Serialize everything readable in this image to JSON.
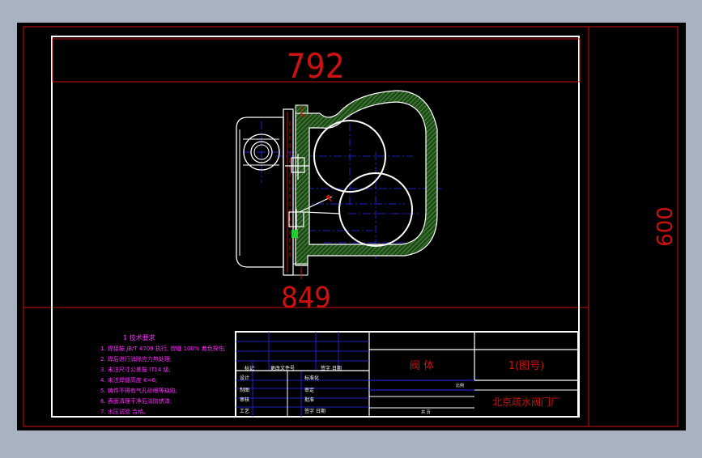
{
  "dimensions": {
    "top": "792",
    "bottom": "849",
    "right": "600"
  },
  "notes": {
    "heading": "1 技术要求",
    "lines": [
      "1. 焊接按 JB/T 4709 执行, 焊缝 100% 着色探伤;",
      "2. 焊后进行消除应力热处理;",
      "3. 未注尺寸公差按 IT14 级;",
      "4. 未注焊缝高度 K=6;",
      "5. 铸件不得有气孔砂眼等缺陷;",
      "6. 表面清理干净后涂防锈漆;",
      "7. 水压试验 合格。"
    ]
  },
  "titleblock": {
    "part_name": "阀   体",
    "drawing_no": "1(图号)",
    "company": "北京疏水阀门厂",
    "label_mark": "标记",
    "label_change_no": "更改文件号",
    "label_sign_date": "签字  日期",
    "label_design": "设计",
    "label_draw": "制图",
    "label_check": "审核",
    "label_process": "工艺",
    "label_std": "标准化",
    "label_review": "审定",
    "label_approve": "批准",
    "label_scale": "比例",
    "label_sheet": "共    页"
  },
  "colors": {
    "frame": "#cc1111",
    "outline": "#ffffff",
    "hatch": "#3a7a2c",
    "center": "#2a2aff",
    "notes": "#ff2cff",
    "title": "#cc1111"
  }
}
